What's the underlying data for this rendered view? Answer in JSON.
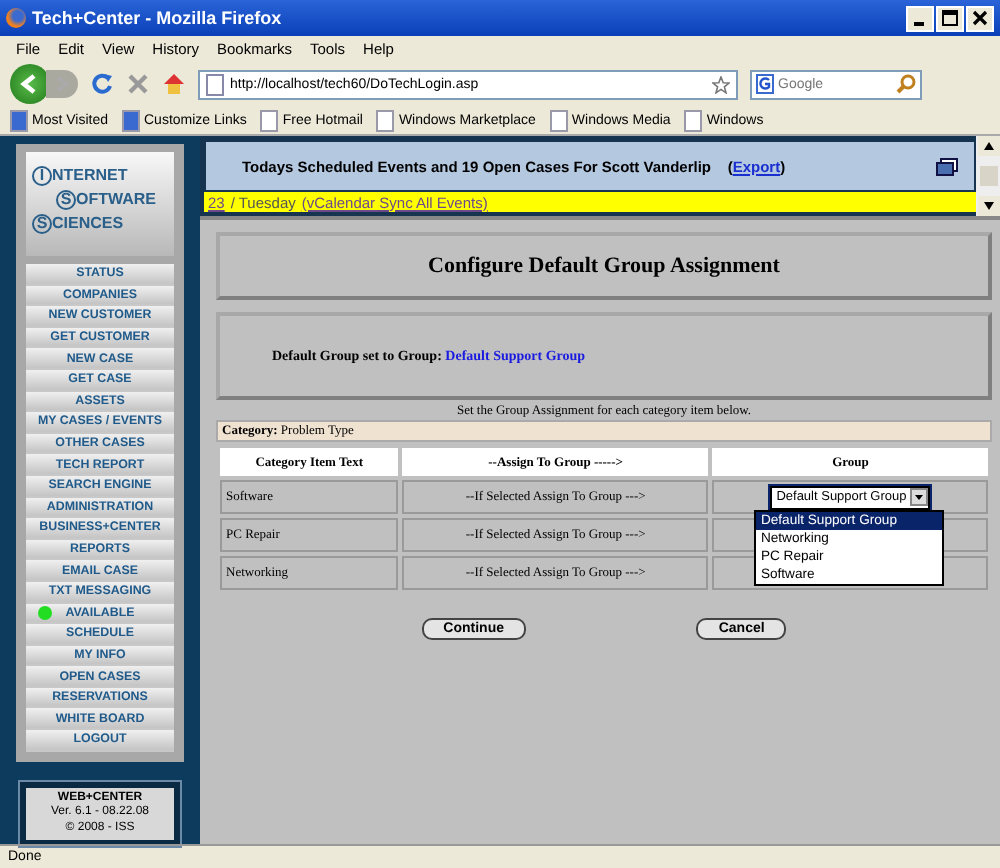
{
  "window": {
    "title": "Tech+Center - Mozilla Firefox"
  },
  "menu": [
    "File",
    "Edit",
    "View",
    "History",
    "Bookmarks",
    "Tools",
    "Help"
  ],
  "address": {
    "value": "http://localhost/tech60/DoTechLogin.asp"
  },
  "search": {
    "placeholder": "Google"
  },
  "bookmarks": [
    "Most Visited",
    "Customize Links",
    "Free Hotmail",
    "Windows Marketplace",
    "Windows Media",
    "Windows"
  ],
  "banner": {
    "headline": "Todays Scheduled Events and 19  Open Cases For  Scott Vanderlip",
    "open": "(",
    "link": "Export",
    "close": ")"
  },
  "date_line": {
    "day": "23",
    "weekday": "/ Tuesday",
    "sync": "(vCalendar Sync All Events)"
  },
  "logo": [
    {
      "initial": "I",
      "rest": "NTERNET"
    },
    {
      "initial": "S",
      "rest": "OFTWARE"
    },
    {
      "initial": "S",
      "rest": "CIENCES"
    }
  ],
  "sidebar": {
    "items": [
      {
        "label": "STATUS"
      },
      {
        "label": "COMPANIES"
      },
      {
        "label": "NEW CUSTOMER"
      },
      {
        "label": "GET CUSTOMER"
      },
      {
        "label": "NEW CASE"
      },
      {
        "label": "GET CASE"
      },
      {
        "label": "ASSETS"
      },
      {
        "label": "MY CASES / EVENTS"
      },
      {
        "label": "OTHER CASES"
      },
      {
        "label": "TECH REPORT"
      },
      {
        "label": "SEARCH ENGINE"
      },
      {
        "label": "ADMINISTRATION"
      },
      {
        "label": "BUSINESS+CENTER"
      },
      {
        "label": "REPORTS"
      },
      {
        "label": "EMAIL CASE"
      },
      {
        "label": "TXT MESSAGING"
      },
      {
        "label": "AVAILABLE",
        "color": "#22dd22"
      },
      {
        "label": "SCHEDULE"
      },
      {
        "label": "MY INFO"
      },
      {
        "label": "OPEN CASES"
      },
      {
        "label": "RESERVATIONS"
      },
      {
        "label": "WHITE BOARD"
      },
      {
        "label": "LOGOUT"
      }
    ]
  },
  "version": {
    "product": "WEB+CENTER",
    "version": "Ver. 6.1 - 08.22.08",
    "copyright": "© 2008 - ISS"
  },
  "page_title": "Configure Default Group Assignment",
  "default_group": {
    "label": "Default Group set to Group:",
    "value": "Default Support Group"
  },
  "instruction": "Set the Group Assignment for each category item below.",
  "category": {
    "label": "Category:",
    "value": "Problem Type"
  },
  "table": {
    "columns": [
      "Category Item Text",
      "--Assign To Group ----->",
      "Group"
    ],
    "rows": [
      {
        "item": "Software",
        "assign": "--If Selected Assign To Group --->",
        "group": {
          "value": "Default Support Group",
          "expanded": true
        }
      },
      {
        "item": "PC Repair",
        "assign": "--If Selected Assign To Group --->"
      },
      {
        "item": "Networking",
        "assign": "--If Selected Assign To Group --->"
      }
    ]
  },
  "dropdown_options": [
    {
      "label": "Default Support Group",
      "selected": true
    },
    {
      "label": "Networking",
      "selected": false
    },
    {
      "label": "PC Repair",
      "selected": false
    },
    {
      "label": "Software",
      "selected": false
    }
  ],
  "buttons": [
    "Continue",
    "Cancel"
  ],
  "status_bar": "Done"
}
